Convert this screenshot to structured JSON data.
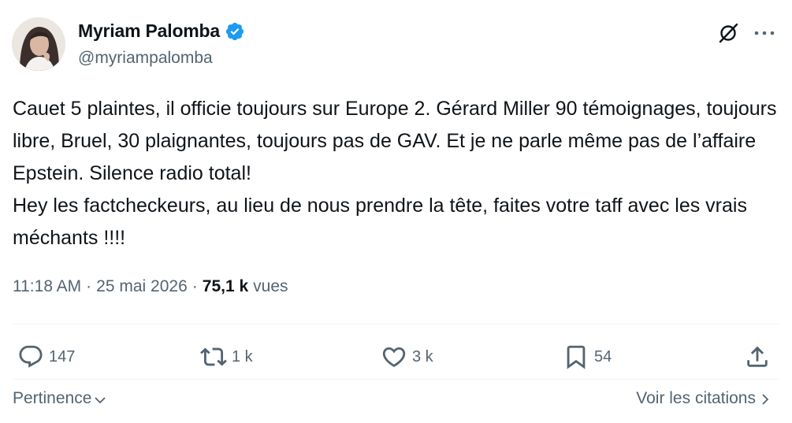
{
  "author": {
    "name": "Myriam Palomba",
    "handle": "@myriampalomba",
    "verified_color": "#1d9bf0",
    "avatar_icon": "profile-photo"
  },
  "tweet": {
    "text": "Cauet 5 plaintes, il officie toujours sur Europe 2. Gérard Miller 90 témoignages, toujours libre, Bruel, 30 plaignantes, toujours pas de GAV. Et je ne parle même pas de l’affaire Epstein. Silence radio total!\nHey les factcheckeurs, au lieu de nous prendre la tête, faites votre taff avec les vrais méchants !!!!",
    "time": "11:18 AM",
    "separator": "·",
    "date": "25 mai 2026",
    "views_count": "75,1 k",
    "views_label": "vues"
  },
  "actions": {
    "replies": "147",
    "reposts": "1 k",
    "likes": "3 k",
    "bookmarks": "54"
  },
  "footer": {
    "sort_label": "Pertinence",
    "quotes_label": "Voir les citations"
  },
  "colors": {
    "text": "#0f1419",
    "secondary": "#536471",
    "accent": "#1d9bf0",
    "divider": "#eff3f4"
  }
}
